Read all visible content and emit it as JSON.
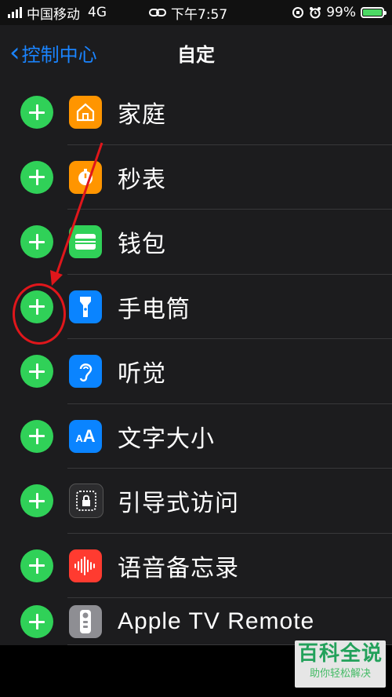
{
  "status_bar": {
    "carrier": "中国移动",
    "network": "4G",
    "time": "下午7:57",
    "battery_percent": "99%",
    "battery_level": 0.99
  },
  "nav": {
    "back_label": "控制中心",
    "title": "自定"
  },
  "items": [
    {
      "label": "家庭",
      "icon": "home-icon",
      "color": "#ff9500"
    },
    {
      "label": "秒表",
      "icon": "stopwatch-icon",
      "color": "#ff9500"
    },
    {
      "label": "钱包",
      "icon": "wallet-icon",
      "color": "#30d158"
    },
    {
      "label": "手电筒",
      "icon": "flashlight-icon",
      "color": "#0a84ff"
    },
    {
      "label": "听觉",
      "icon": "ear-icon",
      "color": "#0a84ff"
    },
    {
      "label": "文字大小",
      "icon": "text-size-icon",
      "color": "#0a84ff"
    },
    {
      "label": "引导式访问",
      "icon": "guided-access-icon",
      "color": "#2c2c2e"
    },
    {
      "label": "语音备忘录",
      "icon": "voice-memo-icon",
      "color": "#ff3b30"
    },
    {
      "label": "Apple TV Remote",
      "icon": "tv-remote-icon",
      "color": "#8e8e93"
    }
  ],
  "watermark": {
    "title": "百科全说",
    "subtitle": "助你轻松解决"
  },
  "colors": {
    "accent": "#0a84ff",
    "add": "#30d158",
    "annotation": "#e0161b"
  }
}
